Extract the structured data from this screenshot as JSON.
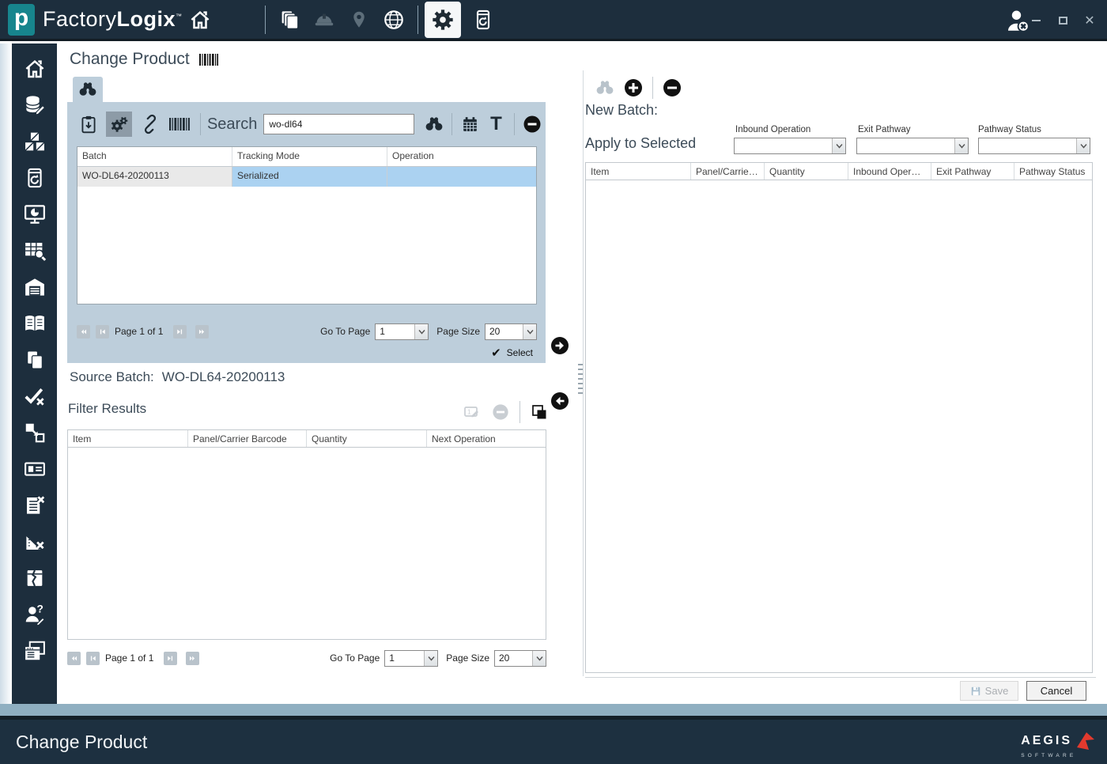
{
  "colors": {
    "navy": "#1d2e3d",
    "panel_bluegray": "#bdcedb",
    "selection_blue": "#abd2f1",
    "logo_teal": "#17858d",
    "accent_red": "#e23a2e",
    "pressed_button": "#8d9ba7"
  },
  "titlebar": {
    "logo_letter": "p",
    "brand_light": "Factory",
    "brand_bold": "Logix",
    "tm": "™"
  },
  "sidebar": {
    "items": [
      "home",
      "data-editor",
      "packaging",
      "device-history",
      "dashboard-monitor",
      "query-viewer",
      "warehouse",
      "documentation",
      "documents",
      "validation",
      "transfer",
      "badges",
      "checklist-remove",
      "measurement-remove",
      "damaged-unit",
      "user-support",
      "reports"
    ]
  },
  "page": {
    "title": "Change Product"
  },
  "batch_panel": {
    "search_label": "Search",
    "search_value": "wo-dl64",
    "columns": [
      "Batch",
      "Tracking Mode",
      "Operation"
    ],
    "row": {
      "batch": "WO-DL64-20200113",
      "tracking_mode": "Serialized",
      "operation": ""
    },
    "pagination": {
      "page_text": "Page 1 of 1",
      "goto_label": "Go To Page",
      "goto_value": "1",
      "size_label": "Page Size",
      "size_value": "20"
    },
    "select_label": "Select"
  },
  "source_batch": {
    "label": "Source Batch:",
    "value": "WO-DL64-20200113"
  },
  "filter_results": {
    "title": "Filter Results",
    "columns": [
      "Item",
      "Panel/Carrier Barcode",
      "Quantity",
      "Next Operation"
    ],
    "pagination": {
      "page_text": "Page 1 of 1",
      "goto_label": "Go To Page",
      "goto_value": "1",
      "size_label": "Page Size",
      "size_value": "20"
    }
  },
  "right_panel": {
    "new_batch_label": "New Batch:",
    "apply_label": "Apply to Selected",
    "dropdowns": [
      {
        "label": "Inbound Operation",
        "value": ""
      },
      {
        "label": "Exit Pathway",
        "value": ""
      },
      {
        "label": "Pathway Status",
        "value": ""
      }
    ],
    "columns": [
      "Item",
      "Panel/Carrier Bar...",
      "Quantity",
      "Inbound Operati...",
      "Exit Pathway",
      "Pathway Status"
    ]
  },
  "footer": {
    "save_label": "Save",
    "cancel_label": "Cancel"
  },
  "statusbar": {
    "title": "Change Product",
    "brand": "AEGIS",
    "brand_sub": "SOFTWARE"
  }
}
